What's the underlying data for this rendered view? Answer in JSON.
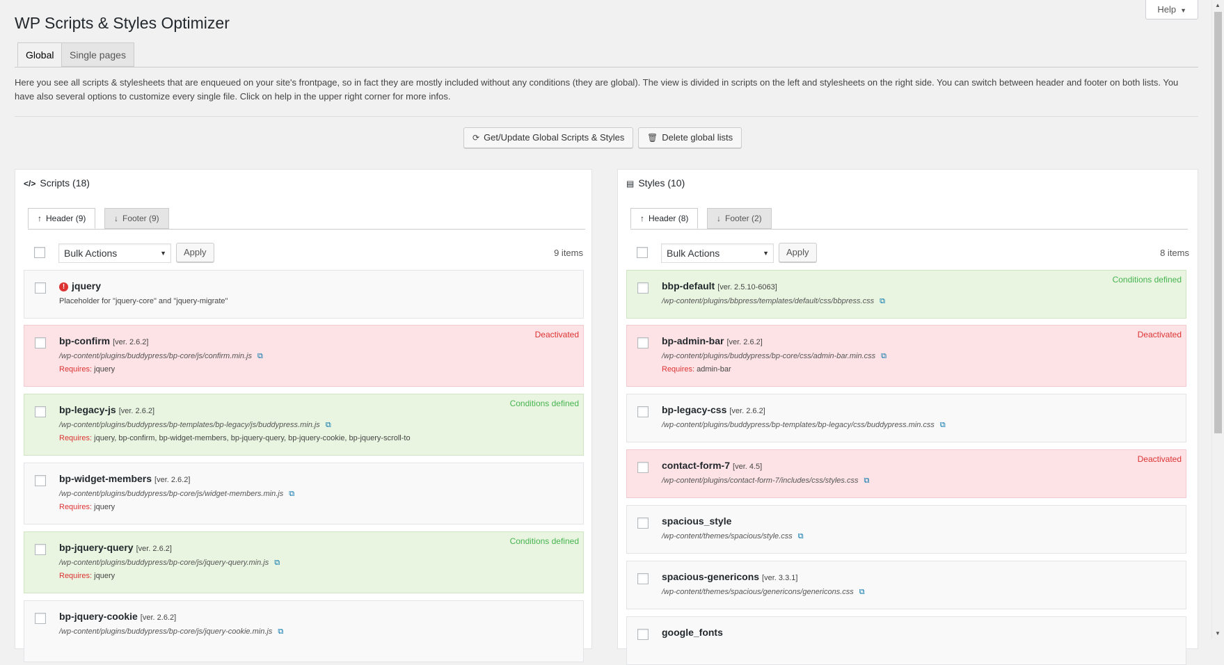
{
  "page": {
    "title": "WP Scripts & Styles Optimizer",
    "help_label": "Help",
    "tabs": [
      "Global",
      "Single pages"
    ],
    "intro": "Here you see all scripts & stylesheets that are enqueued on your site's frontpage, so in fact they are mostly included without any conditions (they are global). The view is divided in scripts on the left and stylesheets on the right side. You can switch between header and footer on both lists. You have also several options to customize every single file. Click on help in the upper right corner for more infos.",
    "update_button": "Get/Update Global Scripts & Styles",
    "delete_button": "Delete global lists"
  },
  "colors": {
    "deactivated_bg": "#fde3e6",
    "conditions_bg": "#e9f5e1",
    "status_red": "#dc3232",
    "status_green": "#46b450",
    "link_blue": "#0073aa"
  },
  "icons": {
    "code": "code-icon",
    "css": "css3-icon",
    "refresh": "refresh-icon",
    "trash": "trash-icon",
    "arrow_up": "arrow-up-icon",
    "arrow_down": "arrow-down-icon",
    "external": "external-link-icon",
    "warning": "warning-icon"
  },
  "scripts": {
    "title": "Scripts (18)",
    "header_tab": "Header (9)",
    "footer_tab": "Footer (9)",
    "bulk_actions": "Bulk Actions",
    "apply": "Apply",
    "count": "9 items",
    "items": [
      {
        "name": "jquery",
        "version": "",
        "path": "",
        "description": "Placeholder for \"jquery-core\" and \"jquery-migrate\"",
        "requires_label": "",
        "requires": "",
        "status": "",
        "warning": "!"
      },
      {
        "name": "bp-confirm",
        "version": "[ver. 2.6.2]",
        "path": "/wp-content/plugins/buddypress/bp-core/js/confirm.min.js",
        "description": "",
        "requires_label": "Requires:",
        "requires": "jquery",
        "status": "Deactivated"
      },
      {
        "name": "bp-legacy-js",
        "version": "[ver. 2.6.2]",
        "path": "/wp-content/plugins/buddypress/bp-templates/bp-legacy/js/buddypress.min.js",
        "description": "",
        "requires_label": "Requires:",
        "requires": "jquery, bp-confirm, bp-widget-members, bp-jquery-query, bp-jquery-cookie, bp-jquery-scroll-to",
        "status": "Conditions defined"
      },
      {
        "name": "bp-widget-members",
        "version": "[ver. 2.6.2]",
        "path": "/wp-content/plugins/buddypress/bp-core/js/widget-members.min.js",
        "description": "",
        "requires_label": "Requires:",
        "requires": "jquery",
        "status": ""
      },
      {
        "name": "bp-jquery-query",
        "version": "[ver. 2.6.2]",
        "path": "/wp-content/plugins/buddypress/bp-core/js/jquery-query.min.js",
        "description": "",
        "requires_label": "Requires:",
        "requires": "jquery",
        "status": "Conditions defined"
      },
      {
        "name": "bp-jquery-cookie",
        "version": "[ver. 2.6.2]",
        "path": "/wp-content/plugins/buddypress/bp-core/js/jquery-cookie.min.js",
        "description": "",
        "requires_label": "",
        "requires": "",
        "status": ""
      }
    ]
  },
  "styles": {
    "title": "Styles (10)",
    "header_tab": "Header (8)",
    "footer_tab": "Footer (2)",
    "bulk_actions": "Bulk Actions",
    "apply": "Apply",
    "count": "8 items",
    "items": [
      {
        "name": "bbp-default",
        "version": "[ver. 2.5.10-6063]",
        "path": "/wp-content/plugins/bbpress/templates/default/css/bbpress.css",
        "requires_label": "",
        "requires": "",
        "status": "Conditions defined"
      },
      {
        "name": "bp-admin-bar",
        "version": "[ver. 2.6.2]",
        "path": "/wp-content/plugins/buddypress/bp-core/css/admin-bar.min.css",
        "requires_label": "Requires:",
        "requires": "admin-bar",
        "status": "Deactivated"
      },
      {
        "name": "bp-legacy-css",
        "version": "[ver. 2.6.2]",
        "path": "/wp-content/plugins/buddypress/bp-templates/bp-legacy/css/buddypress.min.css",
        "requires_label": "",
        "requires": "",
        "status": ""
      },
      {
        "name": "contact-form-7",
        "version": "[ver. 4.5]",
        "path": "/wp-content/plugins/contact-form-7/includes/css/styles.css",
        "requires_label": "",
        "requires": "",
        "status": "Deactivated"
      },
      {
        "name": "spacious_style",
        "version": "",
        "path": "/wp-content/themes/spacious/style.css",
        "requires_label": "",
        "requires": "",
        "status": ""
      },
      {
        "name": "spacious-genericons",
        "version": "[ver. 3.3.1]",
        "path": "/wp-content/themes/spacious/genericons/genericons.css",
        "requires_label": "",
        "requires": "",
        "status": ""
      },
      {
        "name": "google_fonts",
        "version": "",
        "path": "",
        "requires_label": "",
        "requires": "",
        "status": ""
      }
    ]
  }
}
